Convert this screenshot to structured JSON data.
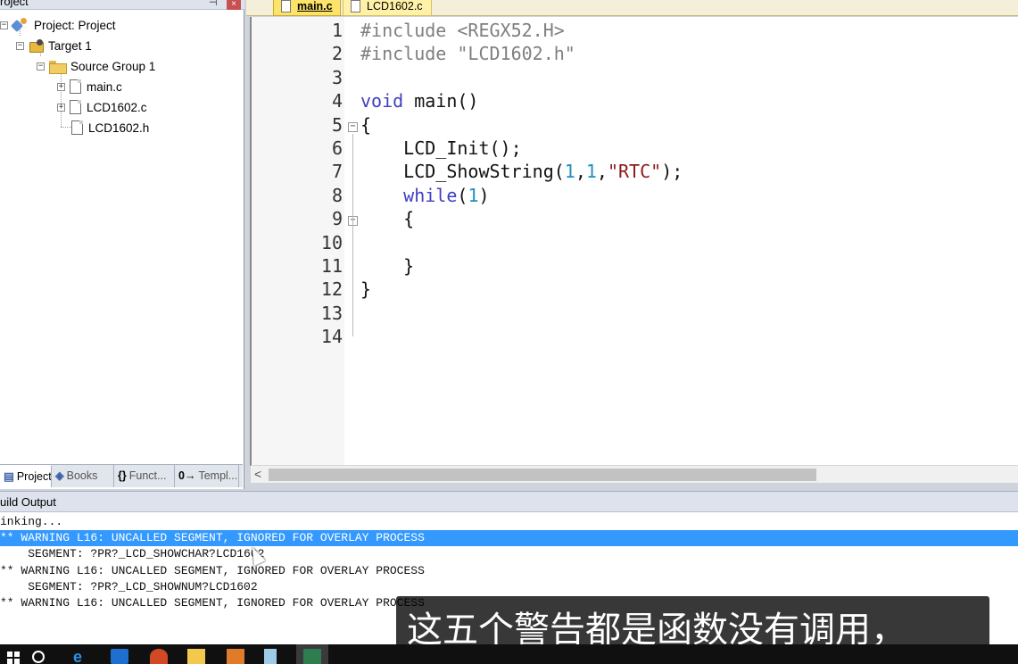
{
  "project_panel": {
    "title": "roject",
    "pin_glyph": "p",
    "close_glyph": "×",
    "tree": [
      {
        "label": "Project: Project",
        "icon": "project-icon",
        "expander": "−"
      },
      {
        "label": "Target 1",
        "icon": "target-icon",
        "expander": "−"
      },
      {
        "label": "Source Group 1",
        "icon": "folder-icon",
        "expander": "−"
      },
      {
        "label": "main.c",
        "icon": "file-icon",
        "expander": "+"
      },
      {
        "label": "LCD1602.c",
        "icon": "file-icon",
        "expander": "+"
      },
      {
        "label": "LCD1602.h",
        "icon": "file-icon",
        "expander": ""
      }
    ],
    "tabs": [
      {
        "label": "Project",
        "icon": "project-tab-icon",
        "active": true
      },
      {
        "label": "Books",
        "icon": "books-icon",
        "active": false
      },
      {
        "label": "Funct...",
        "icon_text": "{}",
        "icon": "functions-icon",
        "active": false
      },
      {
        "label": "Templ...",
        "icon_text": "0→",
        "icon": "templates-icon",
        "active": false
      }
    ]
  },
  "editor": {
    "tabs": [
      {
        "label": "main.c",
        "active": true
      },
      {
        "label": "LCD1602.c",
        "active": false
      }
    ],
    "line_numbers": [
      "1",
      "2",
      "3",
      "4",
      "5",
      "6",
      "7",
      "8",
      "9",
      "10",
      "11",
      "12",
      "13",
      "14"
    ],
    "lines": [
      "#include <REGX52.H>",
      "#include \"LCD1602.h\"",
      "",
      "void main()",
      "{",
      "    LCD_Init();",
      "    LCD_ShowString(1,1,\"RTC\");",
      "    while(1)",
      "    {",
      "",
      "    }",
      "}",
      "",
      ""
    ],
    "fold_markers": {
      "5": "−",
      "9": "−"
    },
    "scroll_left_glyph": "<"
  },
  "build_output": {
    "title": "uild Output",
    "lines": [
      {
        "text": "inking...",
        "selected": false
      },
      {
        "text": "** WARNING L16: UNCALLED SEGMENT, IGNORED FOR OVERLAY PROCESS",
        "selected": true
      },
      {
        "text": "    SEGMENT: ?PR?_LCD_SHOWCHAR?LCD1602",
        "selected": false
      },
      {
        "text": "** WARNING L16: UNCALLED SEGMENT, IGNORED FOR OVERLAY PROCESS",
        "selected": false
      },
      {
        "text": "    SEGMENT: ?PR?_LCD_SHOWNUM?LCD1602",
        "selected": false
      },
      {
        "text": "** WARNING L16: UNCALLED SEGMENT, IGNORED FOR OVERLAY PROCESS",
        "selected": false
      }
    ]
  },
  "subtitle": "这五个警告都是函数没有调用，",
  "taskbar": {
    "items": [
      "start-icon",
      "search-icon",
      "edge-icon",
      "app-icon",
      "powerpoint-icon",
      "file-explorer-icon",
      "app-icon-2",
      "notes-icon",
      "keil-icon"
    ],
    "edge_glyph": "e"
  },
  "colors": {
    "selection": "#3399ff",
    "keyword": "#3f3fc0",
    "active_tab": "#fde36a",
    "number": "#1f8fbf"
  }
}
